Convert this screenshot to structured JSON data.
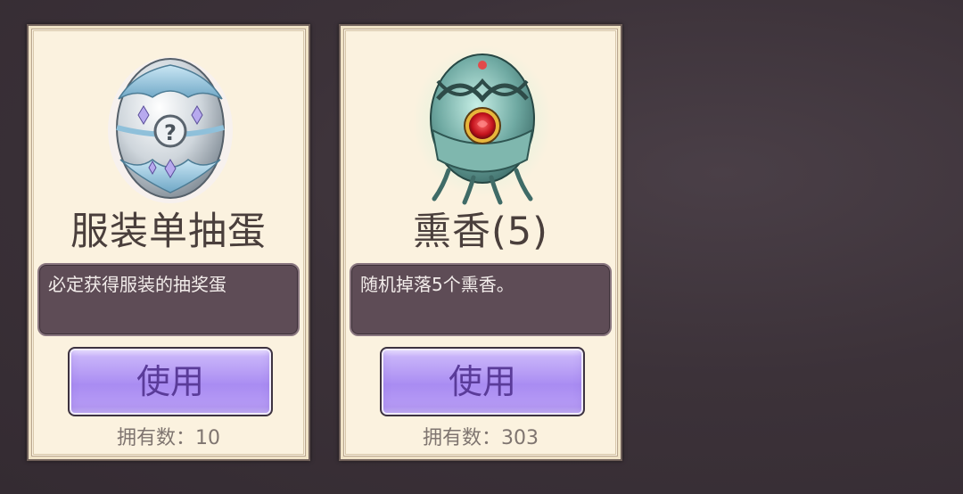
{
  "items": [
    {
      "title": "服装单抽蛋",
      "description": "必定获得服装的抽奖蛋",
      "use_label": "使用",
      "owned_label": "拥有数：",
      "owned_count": "10",
      "icon": "silver-question-egg"
    },
    {
      "title": "熏香(5)",
      "description": "随机掉落5个熏香。",
      "use_label": "使用",
      "owned_label": "拥有数：",
      "owned_count": "303",
      "icon": "teal-rose-egg"
    }
  ],
  "colors": {
    "background": "#3c3239",
    "card": "#fbf2df",
    "title_text": "#4a3f3c",
    "desc_box": "#5e4c56",
    "button": "#a98cf2",
    "button_text": "#5a3b99"
  }
}
